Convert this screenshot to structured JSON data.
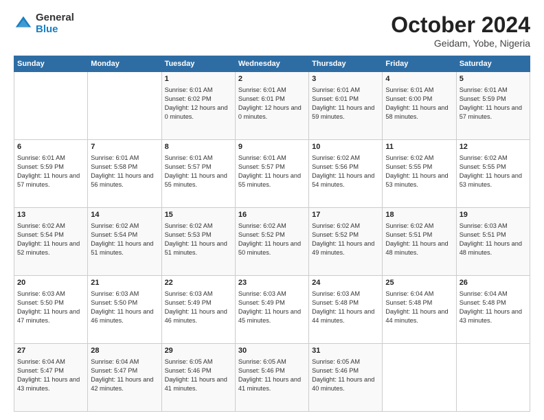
{
  "header": {
    "logo": {
      "general": "General",
      "blue": "Blue"
    },
    "title": "October 2024",
    "location": "Geidam, Yobe, Nigeria"
  },
  "weekdays": [
    "Sunday",
    "Monday",
    "Tuesday",
    "Wednesday",
    "Thursday",
    "Friday",
    "Saturday"
  ],
  "weeks": [
    [
      {
        "day": "",
        "sunrise": "",
        "sunset": "",
        "daylight": ""
      },
      {
        "day": "",
        "sunrise": "",
        "sunset": "",
        "daylight": ""
      },
      {
        "day": "1",
        "sunrise": "Sunrise: 6:01 AM",
        "sunset": "Sunset: 6:02 PM",
        "daylight": "Daylight: 12 hours and 0 minutes."
      },
      {
        "day": "2",
        "sunrise": "Sunrise: 6:01 AM",
        "sunset": "Sunset: 6:01 PM",
        "daylight": "Daylight: 12 hours and 0 minutes."
      },
      {
        "day": "3",
        "sunrise": "Sunrise: 6:01 AM",
        "sunset": "Sunset: 6:01 PM",
        "daylight": "Daylight: 11 hours and 59 minutes."
      },
      {
        "day": "4",
        "sunrise": "Sunrise: 6:01 AM",
        "sunset": "Sunset: 6:00 PM",
        "daylight": "Daylight: 11 hours and 58 minutes."
      },
      {
        "day": "5",
        "sunrise": "Sunrise: 6:01 AM",
        "sunset": "Sunset: 5:59 PM",
        "daylight": "Daylight: 11 hours and 57 minutes."
      }
    ],
    [
      {
        "day": "6",
        "sunrise": "Sunrise: 6:01 AM",
        "sunset": "Sunset: 5:59 PM",
        "daylight": "Daylight: 11 hours and 57 minutes."
      },
      {
        "day": "7",
        "sunrise": "Sunrise: 6:01 AM",
        "sunset": "Sunset: 5:58 PM",
        "daylight": "Daylight: 11 hours and 56 minutes."
      },
      {
        "day": "8",
        "sunrise": "Sunrise: 6:01 AM",
        "sunset": "Sunset: 5:57 PM",
        "daylight": "Daylight: 11 hours and 55 minutes."
      },
      {
        "day": "9",
        "sunrise": "Sunrise: 6:01 AM",
        "sunset": "Sunset: 5:57 PM",
        "daylight": "Daylight: 11 hours and 55 minutes."
      },
      {
        "day": "10",
        "sunrise": "Sunrise: 6:02 AM",
        "sunset": "Sunset: 5:56 PM",
        "daylight": "Daylight: 11 hours and 54 minutes."
      },
      {
        "day": "11",
        "sunrise": "Sunrise: 6:02 AM",
        "sunset": "Sunset: 5:55 PM",
        "daylight": "Daylight: 11 hours and 53 minutes."
      },
      {
        "day": "12",
        "sunrise": "Sunrise: 6:02 AM",
        "sunset": "Sunset: 5:55 PM",
        "daylight": "Daylight: 11 hours and 53 minutes."
      }
    ],
    [
      {
        "day": "13",
        "sunrise": "Sunrise: 6:02 AM",
        "sunset": "Sunset: 5:54 PM",
        "daylight": "Daylight: 11 hours and 52 minutes."
      },
      {
        "day": "14",
        "sunrise": "Sunrise: 6:02 AM",
        "sunset": "Sunset: 5:54 PM",
        "daylight": "Daylight: 11 hours and 51 minutes."
      },
      {
        "day": "15",
        "sunrise": "Sunrise: 6:02 AM",
        "sunset": "Sunset: 5:53 PM",
        "daylight": "Daylight: 11 hours and 51 minutes."
      },
      {
        "day": "16",
        "sunrise": "Sunrise: 6:02 AM",
        "sunset": "Sunset: 5:52 PM",
        "daylight": "Daylight: 11 hours and 50 minutes."
      },
      {
        "day": "17",
        "sunrise": "Sunrise: 6:02 AM",
        "sunset": "Sunset: 5:52 PM",
        "daylight": "Daylight: 11 hours and 49 minutes."
      },
      {
        "day": "18",
        "sunrise": "Sunrise: 6:02 AM",
        "sunset": "Sunset: 5:51 PM",
        "daylight": "Daylight: 11 hours and 48 minutes."
      },
      {
        "day": "19",
        "sunrise": "Sunrise: 6:03 AM",
        "sunset": "Sunset: 5:51 PM",
        "daylight": "Daylight: 11 hours and 48 minutes."
      }
    ],
    [
      {
        "day": "20",
        "sunrise": "Sunrise: 6:03 AM",
        "sunset": "Sunset: 5:50 PM",
        "daylight": "Daylight: 11 hours and 47 minutes."
      },
      {
        "day": "21",
        "sunrise": "Sunrise: 6:03 AM",
        "sunset": "Sunset: 5:50 PM",
        "daylight": "Daylight: 11 hours and 46 minutes."
      },
      {
        "day": "22",
        "sunrise": "Sunrise: 6:03 AM",
        "sunset": "Sunset: 5:49 PM",
        "daylight": "Daylight: 11 hours and 46 minutes."
      },
      {
        "day": "23",
        "sunrise": "Sunrise: 6:03 AM",
        "sunset": "Sunset: 5:49 PM",
        "daylight": "Daylight: 11 hours and 45 minutes."
      },
      {
        "day": "24",
        "sunrise": "Sunrise: 6:03 AM",
        "sunset": "Sunset: 5:48 PM",
        "daylight": "Daylight: 11 hours and 44 minutes."
      },
      {
        "day": "25",
        "sunrise": "Sunrise: 6:04 AM",
        "sunset": "Sunset: 5:48 PM",
        "daylight": "Daylight: 11 hours and 44 minutes."
      },
      {
        "day": "26",
        "sunrise": "Sunrise: 6:04 AM",
        "sunset": "Sunset: 5:48 PM",
        "daylight": "Daylight: 11 hours and 43 minutes."
      }
    ],
    [
      {
        "day": "27",
        "sunrise": "Sunrise: 6:04 AM",
        "sunset": "Sunset: 5:47 PM",
        "daylight": "Daylight: 11 hours and 43 minutes."
      },
      {
        "day": "28",
        "sunrise": "Sunrise: 6:04 AM",
        "sunset": "Sunset: 5:47 PM",
        "daylight": "Daylight: 11 hours and 42 minutes."
      },
      {
        "day": "29",
        "sunrise": "Sunrise: 6:05 AM",
        "sunset": "Sunset: 5:46 PM",
        "daylight": "Daylight: 11 hours and 41 minutes."
      },
      {
        "day": "30",
        "sunrise": "Sunrise: 6:05 AM",
        "sunset": "Sunset: 5:46 PM",
        "daylight": "Daylight: 11 hours and 41 minutes."
      },
      {
        "day": "31",
        "sunrise": "Sunrise: 6:05 AM",
        "sunset": "Sunset: 5:46 PM",
        "daylight": "Daylight: 11 hours and 40 minutes."
      },
      {
        "day": "",
        "sunrise": "",
        "sunset": "",
        "daylight": ""
      },
      {
        "day": "",
        "sunrise": "",
        "sunset": "",
        "daylight": ""
      }
    ]
  ]
}
